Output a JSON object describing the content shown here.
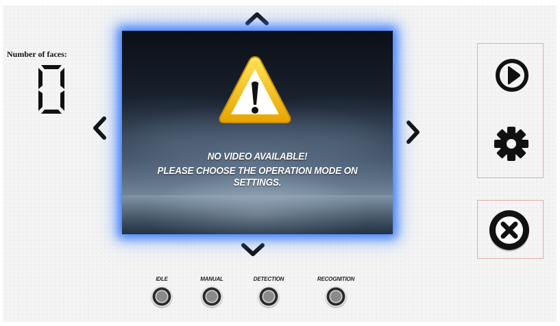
{
  "faces": {
    "label": "Number of faces:",
    "count": "0"
  },
  "video": {
    "line1": "NO VIDEO AVAILABLE!",
    "line2": "PLEASE CHOOSE THE OPERATION MODE ON SETTINGS."
  },
  "nav": {
    "up": "chevron-up-icon",
    "down": "chevron-down-icon",
    "left": "chevron-left-icon",
    "right": "chevron-right-icon"
  },
  "controls": {
    "play": "play-icon",
    "settings": "gear-icon",
    "exit": "close-circle-icon"
  },
  "modes": [
    {
      "label": "IDLE"
    },
    {
      "label": "MANUAL"
    },
    {
      "label": "DETECTION"
    },
    {
      "label": "RECOGNITION"
    }
  ],
  "colors": {
    "glow": "#2f6fff",
    "panel_border": "#e2a9a9",
    "warning": "#f2c21b"
  }
}
